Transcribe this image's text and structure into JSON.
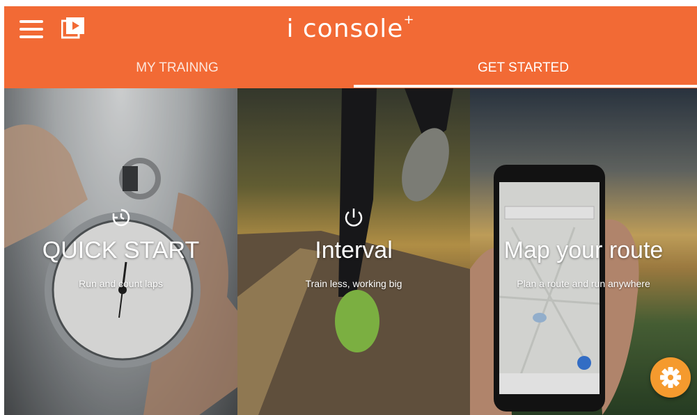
{
  "app": {
    "title": "i console",
    "title_suffix": "+"
  },
  "header": {
    "menu_icon": "hamburger-menu-icon",
    "video_icon": "video-library-icon"
  },
  "tabs": [
    {
      "label": "MY TRAINNG",
      "active": false
    },
    {
      "label": "GET STARTED",
      "active": true
    }
  ],
  "panels": [
    {
      "title": "QUICK START",
      "subtitle": "Run and count laps",
      "icon": "timer-reset-icon"
    },
    {
      "title": "Interval",
      "subtitle": "Train less, working big",
      "icon": "power-icon"
    },
    {
      "title": "Map your route",
      "subtitle": "Plan a route and run anywhere",
      "icon": ""
    }
  ],
  "fab": {
    "icon": "settings-gear-icon"
  },
  "colors": {
    "primary": "#f26a35",
    "fab": "#f59a2e",
    "text": "#ffffff"
  }
}
